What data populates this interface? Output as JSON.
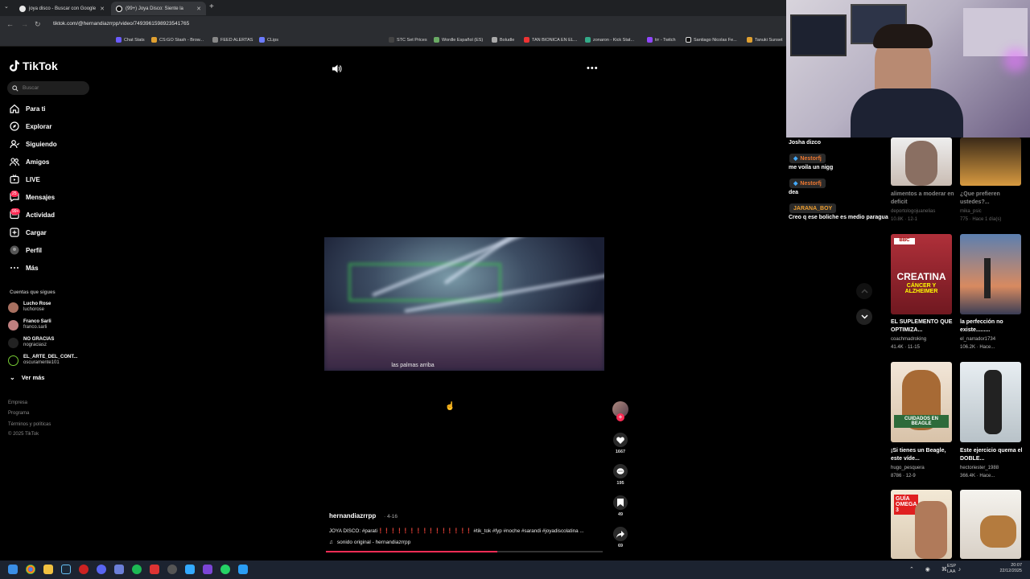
{
  "browser": {
    "tabs": [
      {
        "title": "joya disco - Buscar con Google"
      },
      {
        "title": "(99+) Joya Disco: Siente la"
      }
    ],
    "url": "tiktok.com/@hernandiazrrpp/video/7493961598923541765",
    "bookmarks": [
      "Chat Stats",
      "CS:GO Stash - Brow...",
      "FEED ALERTAS",
      "CLips",
      "STC Set Prices",
      "Wordle Español (ES)",
      "Boludle",
      "TAN BIONICA EN EL...",
      "zonaron - Kick Stat...",
      "trr - Twitch",
      "Santiago Nicolas Fe...",
      "Tanuki Sunset"
    ]
  },
  "tiktok": {
    "logo": "TikTok",
    "search_placeholder": "Buscar",
    "nav": [
      {
        "label": "Para ti",
        "icon": "home-icon"
      },
      {
        "label": "Explorar",
        "icon": "compass-icon"
      },
      {
        "label": "Siguiendo",
        "icon": "following-icon"
      },
      {
        "label": "Amigos",
        "icon": "friends-icon"
      },
      {
        "label": "LIVE",
        "icon": "live-icon"
      },
      {
        "label": "Mensajes",
        "icon": "messages-icon"
      },
      {
        "label": "Actividad",
        "icon": "activity-icon"
      },
      {
        "label": "Cargar",
        "icon": "upload-icon"
      },
      {
        "label": "Perfil",
        "icon": "profile-icon"
      },
      {
        "label": "Más",
        "icon": "more-icon"
      }
    ],
    "messages_badge": "25",
    "activity_badge": "99+",
    "following_title": "Cuentas que sigues",
    "following": [
      {
        "name": "Lucho Rose",
        "handle": "luchorose"
      },
      {
        "name": "Franco Sarli",
        "handle": "franco.sarli"
      },
      {
        "name": "NO GRACIAS",
        "handle": "nograciasz"
      },
      {
        "name": "EL_ARTE_DEL_CONT...",
        "handle": "oscuramente101"
      }
    ],
    "see_more": "Ver más",
    "footer": [
      "Empresa",
      "Programa",
      "Términos y políticas",
      "© 2025 TikTok"
    ]
  },
  "video": {
    "subtitle": "las palmas arriba",
    "likes": "1667",
    "comments": "195",
    "saves": "49",
    "shares": "69",
    "author": "hernandiazrrpp",
    "date": "· 4-16",
    "caption": "JOYA DISCO: #parati❗❗❗❗❗❗❗❗❗❗❗❗❗❗❗ #tik_tok #fyp #noche #sarandi #joyadiscolatina ...",
    "sound": "sonido original - hernandiazrrpp",
    "progress": 0.62
  },
  "chat": [
    {
      "user": "Josha dizco",
      "message": ""
    },
    {
      "user": "Nestorfj",
      "message": "me voila un nigg"
    },
    {
      "user": "Nestorfj",
      "message": "dea"
    },
    {
      "user": "JARANA_BOY",
      "message": "Creo q ese boliche es medio paragua"
    }
  ],
  "recommendations": [
    {
      "title": "alimentos a moderar en deficit",
      "author": "deportologojuanelias",
      "stats": "10.8K · 12-1"
    },
    {
      "title": "¿Que prefieren ustedes?...",
      "author": "mika_psic",
      "stats": "775 · Hace 1 día(s)"
    },
    {
      "title": "EL SUPLEMENTO QUE OPTIMIZA...",
      "author": "coachmadroking",
      "stats": "41.4K · 11-15",
      "overlay": "CREATINA",
      "overlay2": "CÁNCER Y ALZHEIMER"
    },
    {
      "title": "la perfección no existe.........",
      "author": "el_narrador1734",
      "stats": "106.2K · Hace..."
    },
    {
      "title": "¡Si tienes un Beagle, este víde...",
      "author": "hugo_pesquera",
      "stats": "8786 · 12-9",
      "overlay": "CUIDADOS EN BEAGLE"
    },
    {
      "title": "Este ejercicio quema el DOBLE...",
      "author": "hectoriester_1988",
      "stats": "366.4K · Hace..."
    },
    {
      "title": "",
      "author": "",
      "stats": "",
      "overlay": "GUÍA OMEGA 3"
    },
    {
      "title": "",
      "author": "",
      "stats": ""
    }
  ],
  "tray": {
    "lang": "ESP\nLAA",
    "time": "20:07",
    "date": "22/12/2025"
  },
  "colors": {
    "accent": "#fe2c55",
    "bg": "#000000"
  }
}
